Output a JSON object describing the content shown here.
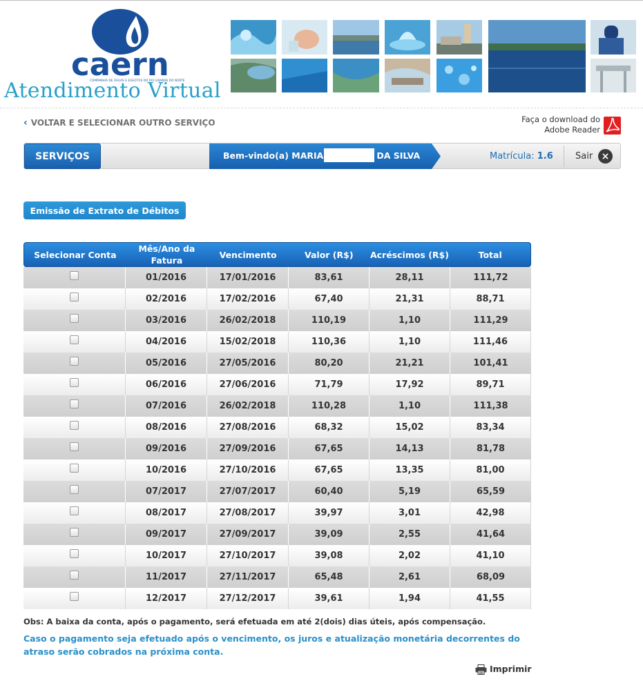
{
  "header": {
    "logo_text": "caern",
    "logo_subtitle": "COMPANHIA DE ÁGUAS E ESGOTOS DO RIO GRANDE DO NORTE",
    "brand_title": "Atendimento Virtual"
  },
  "nav": {
    "back_label": "VOLTAR E SELECIONAR OUTRO SERVIÇO",
    "adobe_line1": "Faça o download do",
    "adobe_line2": "Adobe Reader",
    "servicos_label": "SERVIÇOS",
    "welcome_prefix": "Bem-vindo(a) MARIA",
    "welcome_suffix": "DA SILVA",
    "matricula_label": "Matrícula:",
    "matricula_value": "1.6",
    "sair_label": "Sair"
  },
  "tab": {
    "label": "Emissão de Extrato de Débitos"
  },
  "table": {
    "headers": [
      "Selecionar Conta",
      "Mês/Ano da Fatura",
      "Vencimento",
      "Valor (R$)",
      "Acréscimos (R$)",
      "Total"
    ],
    "rows": [
      {
        "mes": "01/2016",
        "venc": "17/01/2016",
        "valor": "83,61",
        "acres": "28,11",
        "total": "111,72"
      },
      {
        "mes": "02/2016",
        "venc": "17/02/2016",
        "valor": "67,40",
        "acres": "21,31",
        "total": "88,71"
      },
      {
        "mes": "03/2016",
        "venc": "26/02/2018",
        "valor": "110,19",
        "acres": "1,10",
        "total": "111,29"
      },
      {
        "mes": "04/2016",
        "venc": "15/02/2018",
        "valor": "110,36",
        "acres": "1,10",
        "total": "111,46"
      },
      {
        "mes": "05/2016",
        "venc": "27/05/2016",
        "valor": "80,20",
        "acres": "21,21",
        "total": "101,41"
      },
      {
        "mes": "06/2016",
        "venc": "27/06/2016",
        "valor": "71,79",
        "acres": "17,92",
        "total": "89,71"
      },
      {
        "mes": "07/2016",
        "venc": "26/02/2018",
        "valor": "110,28",
        "acres": "1,10",
        "total": "111,38"
      },
      {
        "mes": "08/2016",
        "venc": "27/08/2016",
        "valor": "68,32",
        "acres": "15,02",
        "total": "83,34"
      },
      {
        "mes": "09/2016",
        "venc": "27/09/2016",
        "valor": "67,65",
        "acres": "14,13",
        "total": "81,78"
      },
      {
        "mes": "10/2016",
        "venc": "27/10/2016",
        "valor": "67,65",
        "acres": "13,35",
        "total": "81,00"
      },
      {
        "mes": "07/2017",
        "venc": "27/07/2017",
        "valor": "60,40",
        "acres": "5,19",
        "total": "65,59"
      },
      {
        "mes": "08/2017",
        "venc": "27/08/2017",
        "valor": "39,97",
        "acres": "3,01",
        "total": "42,98"
      },
      {
        "mes": "09/2017",
        "venc": "27/09/2017",
        "valor": "39,09",
        "acres": "2,55",
        "total": "41,64"
      },
      {
        "mes": "10/2017",
        "venc": "27/10/2017",
        "valor": "39,08",
        "acres": "2,02",
        "total": "41,10"
      },
      {
        "mes": "11/2017",
        "venc": "27/11/2017",
        "valor": "65,48",
        "acres": "2,61",
        "total": "68,09"
      },
      {
        "mes": "12/2017",
        "venc": "27/12/2017",
        "valor": "39,61",
        "acres": "1,94",
        "total": "41,55"
      }
    ]
  },
  "footer": {
    "obs": "Obs: A baixa da conta, após o pagamento, será efetuada em até 2(dois) dias úteis, após compensação.",
    "warning": "Caso o pagamento seja efetuado após o vencimento, os juros e atualização monetária decorrentes do atraso serão cobrados na próxima conta.",
    "print_label": "Imprimir"
  },
  "colors": {
    "brand_blue": "#1a4f9c",
    "accent_blue": "#2a8fc9",
    "nav_blue": "#1a5fab"
  }
}
